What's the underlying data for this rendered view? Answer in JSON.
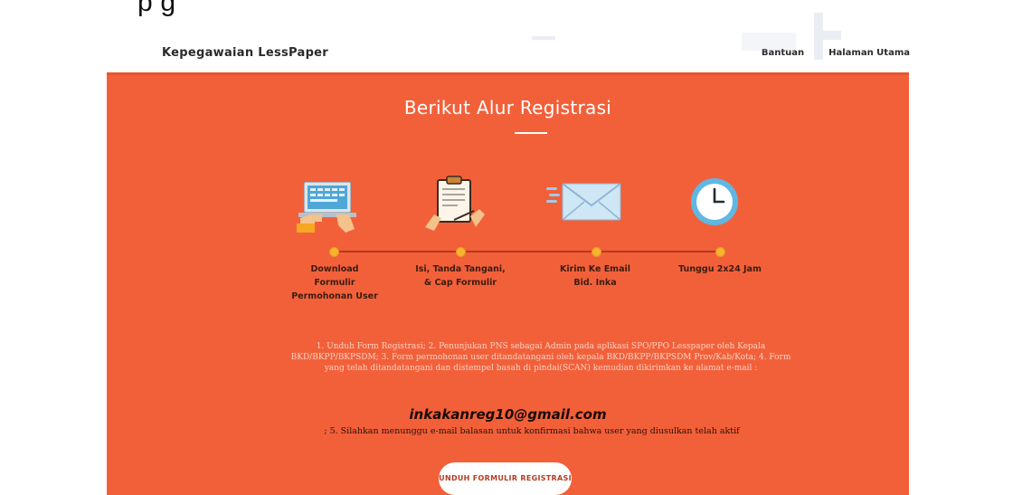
{
  "caption": {
    "text": "p                                          g"
  },
  "navbar": {
    "brand": "Kepegawaian LessPaper",
    "links": [
      {
        "label": "Bantuan"
      },
      {
        "label": "Halaman Utama"
      }
    ]
  },
  "section": {
    "title": "Berikut Alur Registrasi",
    "background_color": "#f2603a",
    "steps": [
      {
        "label": "Download Formulir Permohonan User",
        "icon": "laptop-download-icon"
      },
      {
        "label": "Isi, Tanda Tangani, & Cap Formulir",
        "icon": "clipboard-sign-icon"
      },
      {
        "label": "Kirim Ke Email Bid. Inka",
        "icon": "envelope-icon"
      },
      {
        "label": "Tunggu 2x24 Jam",
        "icon": "clock-icon"
      }
    ],
    "instructions": "1. Unduh Form Registrasi; 2. Penunjukan PNS sebagai Admin pada aplikasi SPO/PPO Lesspaper oleh Kepala BKD/BKPP/BKPSDM; 3. Form permohonan user ditandatangani oleh kepala BKD/BKPP/BKPSDM Prov/Kab/Kota; 4. Form yang telah ditandatangani dan distempel basah di pindai(SCAN) kemudian dikirimkan ke alamat e-mail :",
    "email": "inkakanreg10@gmail.com",
    "note": "; 5. Silahkan menunggu e-mail balasan untuk konfirmasi bahwa user yang diusulkan telah aktif",
    "download_button": "UNDUH FORMULIR REGISTRASI"
  }
}
